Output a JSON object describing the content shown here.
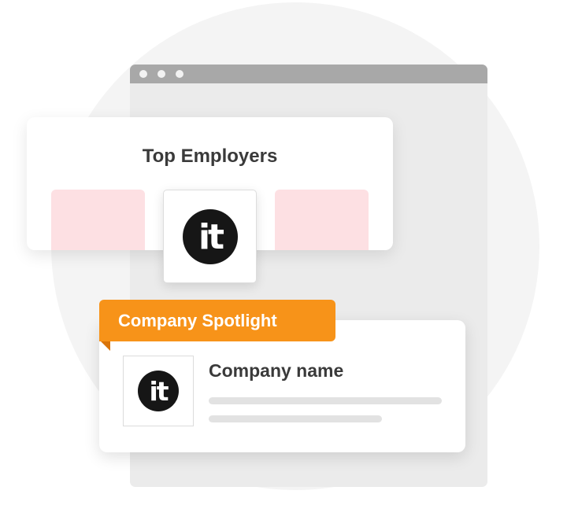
{
  "top_card": {
    "title": "Top Employers"
  },
  "logo": {
    "text": "it",
    "color": "#161616"
  },
  "spotlight": {
    "tab_label": "Company Spotlight",
    "company_name": "Company name",
    "accent_color": "#f79319"
  },
  "colors": {
    "placeholder_tile": "#fde0e3",
    "browser_bar": "#a8a8a8",
    "background_circle": "#f4f4f4"
  }
}
